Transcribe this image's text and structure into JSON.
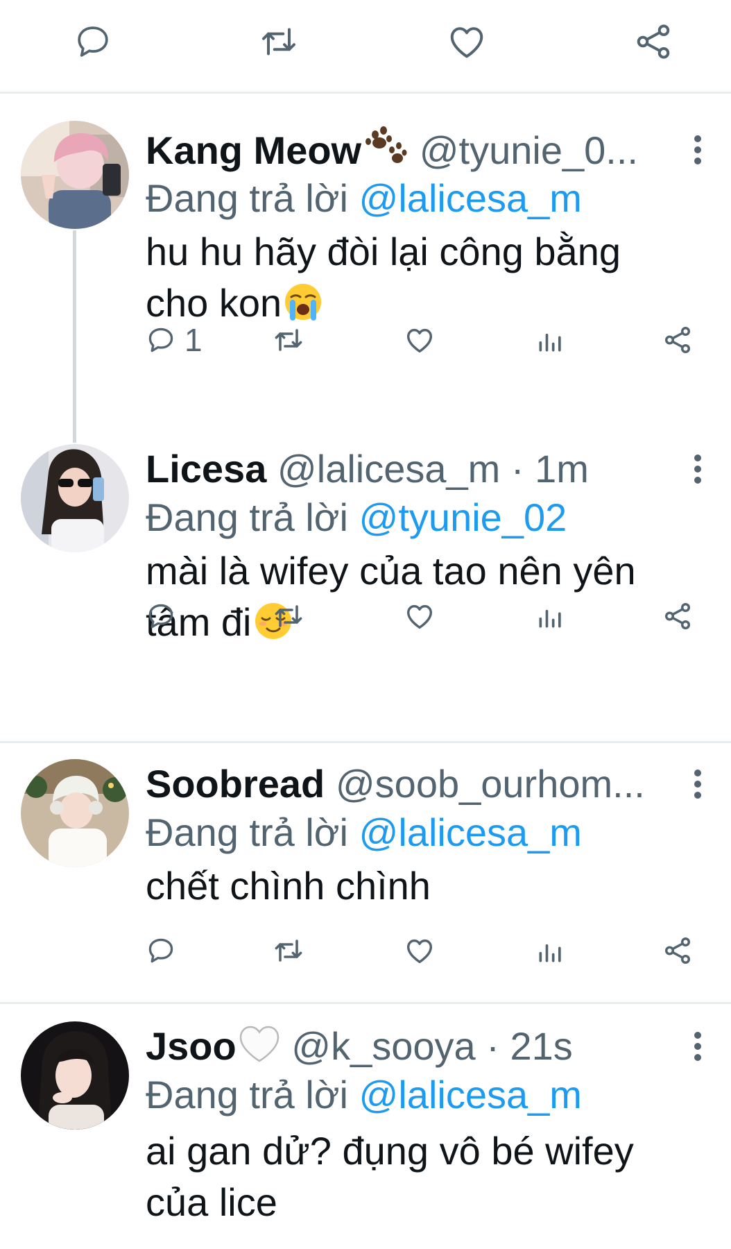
{
  "top_actions": {
    "icons": [
      "reply-icon",
      "retweet-icon",
      "like-icon",
      "share-icon"
    ]
  },
  "colors": {
    "text": "#0f1419",
    "secondary": "#536471",
    "link": "#1d9bf0",
    "divider": "#e9ecef",
    "thread_line": "#cfd9de"
  },
  "replies": [
    {
      "name": "Kang Meow",
      "name_emoji": "paw-prints",
      "handle": "@tyunie_0...",
      "time": "",
      "replying_prefix": "Đang trả lời",
      "replying_to": "@lalicesa_m",
      "text_line1": "hu hu hãy đòi lại công bằng",
      "text_line2": "cho kon",
      "text_emoji": "loudly-crying-face",
      "reply_count": "1"
    },
    {
      "name": "Licesa",
      "name_emoji": "",
      "handle": "@lalicesa_m",
      "time": "1m",
      "replying_prefix": "Đang trả lời",
      "replying_to": "@tyunie_02",
      "text_line1": "mài là wifey của tao nên yên",
      "text_line2": "tâm đi",
      "text_emoji": "relieved-face",
      "reply_count": ""
    },
    {
      "name": "Soobread",
      "name_emoji": "",
      "handle": "@soob_ourhom...",
      "time": "",
      "replying_prefix": "Đang trả lời",
      "replying_to": "@lalicesa_m",
      "text_line1": "chết chình chình",
      "text_line2": "",
      "text_emoji": "",
      "reply_count": ""
    },
    {
      "name": "Jsoo",
      "name_emoji": "white-heart",
      "handle": "@k_sooya",
      "time": "21s",
      "replying_prefix": "Đang trả lời",
      "replying_to": "@lalicesa_m",
      "text_line1": "ai gan dử? đụng vô bé wifey",
      "text_line2": "của lice",
      "text_emoji": "",
      "reply_count": ""
    }
  ]
}
